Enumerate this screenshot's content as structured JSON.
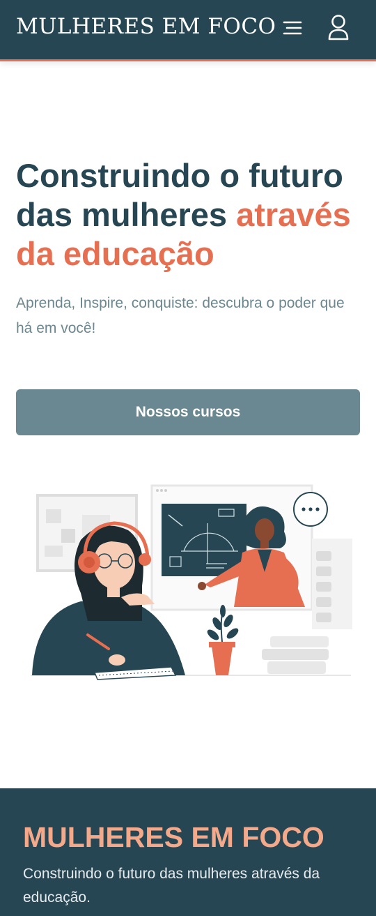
{
  "header": {
    "brand": "MULHERES EM FOCO",
    "menu_icon": "menu-icon",
    "user_icon": "user-icon"
  },
  "hero": {
    "title_main": "Construindo o futuro das mulheres",
    "title_accent": "através da educação",
    "subtitle": "Aprenda, Inspire, conquiste: descubra o poder que há em você!",
    "cta_label": "Nossos cursos",
    "illustration": "online-class-illustration"
  },
  "footer": {
    "title": "MULHERES EM FOCO",
    "text": "Construindo o futuro das mulheres através da educação."
  },
  "colors": {
    "primary": "#264653",
    "accent": "#e76f51",
    "button": "#6a8891",
    "footer_title": "#f4a98a",
    "subtitle": "#6c8790"
  }
}
